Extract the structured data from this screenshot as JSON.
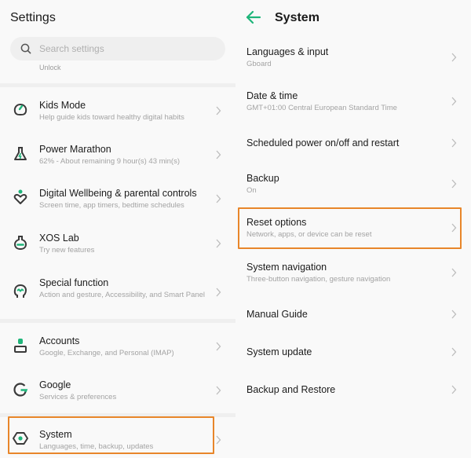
{
  "left": {
    "title": "Settings",
    "search": {
      "placeholder": "Search settings",
      "value": ""
    },
    "ghost_text": "Unlock",
    "items": [
      {
        "id": "kids-mode",
        "label": "Kids Mode",
        "sub": "Help guide kids toward healthy digital habits",
        "icon": "kids-mode-icon"
      },
      {
        "id": "power-marathon",
        "label": "Power Marathon",
        "sub": "62% - About remaining 9 hour(s)  43 min(s)",
        "icon": "flask-icon"
      },
      {
        "id": "digital-wellbeing",
        "label": "Digital Wellbeing & parental controls",
        "sub": "Screen time, app timers, bedtime schedules",
        "icon": "wellbeing-heart-icon"
      },
      {
        "id": "xos-lab",
        "label": "XOS Lab",
        "sub": "Try new features",
        "icon": "lab-flask-icon"
      },
      {
        "id": "special-function",
        "label": "Special function",
        "sub": "Action and gesture, Accessibility, and Smart Panel",
        "icon": "head-gesture-icon"
      },
      {
        "id": "accounts",
        "label": "Accounts",
        "sub": "Google, Exchange, and Personal (IMAP)",
        "icon": "account-icon"
      },
      {
        "id": "google",
        "label": "Google",
        "sub": "Services & preferences",
        "icon": "google-g-icon"
      },
      {
        "id": "system",
        "label": "System",
        "sub": "Languages, time, backup, updates",
        "icon": "system-hexagon-icon",
        "highlighted": true
      }
    ]
  },
  "right": {
    "title": "System",
    "back_icon": "back-arrow-icon",
    "items": [
      {
        "id": "languages-input",
        "label": "Languages & input",
        "sub": "Gboard"
      },
      {
        "id": "date-time",
        "label": "Date & time",
        "sub": "GMT+01:00 Central European Standard Time"
      },
      {
        "id": "scheduled-power",
        "label": "Scheduled power on/off and restart",
        "sub": ""
      },
      {
        "id": "backup",
        "label": "Backup",
        "sub": "On"
      },
      {
        "id": "reset-options",
        "label": "Reset options",
        "sub": "Network, apps, or device can be reset",
        "highlighted": true
      },
      {
        "id": "system-navigation",
        "label": "System navigation",
        "sub": "Three-button navigation, gesture navigation"
      },
      {
        "id": "manual-guide",
        "label": "Manual Guide",
        "sub": ""
      },
      {
        "id": "system-update",
        "label": "System update",
        "sub": ""
      },
      {
        "id": "backup-restore",
        "label": "Backup and Restore",
        "sub": ""
      }
    ]
  },
  "colors": {
    "accent_green": "#1fb57a",
    "icon_dark": "#3a3a3a",
    "highlight_orange": "#e8862a"
  }
}
